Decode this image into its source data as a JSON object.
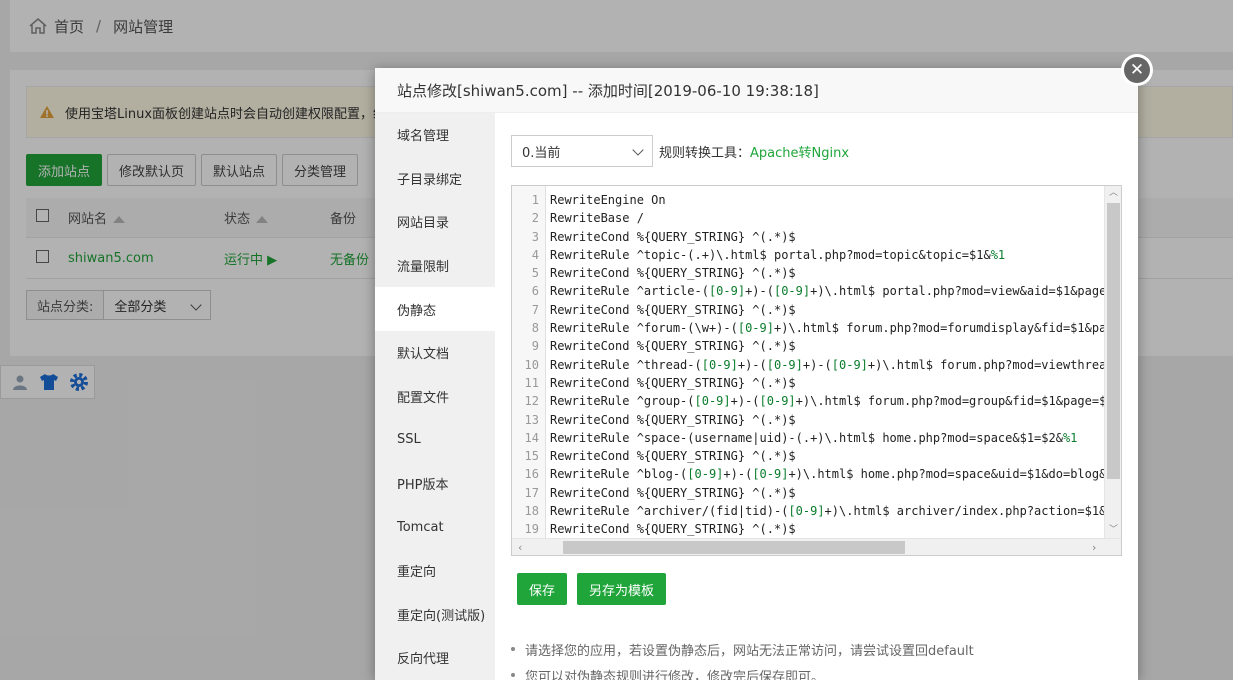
{
  "breadcrumb": {
    "home": "首页",
    "separator": "/",
    "current": "网站管理"
  },
  "alert": {
    "text": "使用宝塔Linux面板创建站点时会自动创建权限配置，统"
  },
  "toolbar": {
    "buttons": [
      "添加站点",
      "修改默认页",
      "默认站点",
      "分类管理"
    ]
  },
  "table": {
    "headers": {
      "name": "网站名",
      "status": "状态",
      "backup": "备份"
    },
    "rows": [
      {
        "name": "shiwan5.com",
        "status": "运行中 ▶",
        "backup": "无备份"
      }
    ]
  },
  "category": {
    "label": "站点分类:",
    "value": "全部分类"
  },
  "modal": {
    "title": "站点修改[shiwan5.com] -- 添加时间[2019-06-10 19:38:18]",
    "close": "✕",
    "nav": [
      "域名管理",
      "子目录绑定",
      "网站目录",
      "流量限制",
      "伪静态",
      "默认文档",
      "配置文件",
      "SSL",
      "PHP版本",
      "Tomcat",
      "重定向",
      "重定向(测试版)",
      "反向代理"
    ],
    "active_nav": "伪静态",
    "version_select": "0.当前",
    "tool_label": "规则转换工具：",
    "tool_link": "Apache转Nginx",
    "code_lines": [
      "RewriteEngine On",
      "RewriteBase /",
      "RewriteCond %{QUERY_STRING} ^(.*)$",
      "RewriteRule ^topic-(.+)\\.html$ portal.php?mod=topic&topic=$1&%1",
      "RewriteCond %{QUERY_STRING} ^(.*)$",
      "RewriteRule ^article-([0-9]+)-([0-9]+)\\.html$ portal.php?mod=view&aid=$1&page",
      "RewriteCond %{QUERY_STRING} ^(.*)$",
      "RewriteRule ^forum-(\\w+)-([0-9]+)\\.html$ forum.php?mod=forumdisplay&fid=$1&pa",
      "RewriteCond %{QUERY_STRING} ^(.*)$",
      "RewriteRule ^thread-([0-9]+)-([0-9]+)-([0-9]+)\\.html$ forum.php?mod=viewthrea",
      "RewriteCond %{QUERY_STRING} ^(.*)$",
      "RewriteRule ^group-([0-9]+)-([0-9]+)\\.html$ forum.php?mod=group&fid=$1&page=$",
      "RewriteCond %{QUERY_STRING} ^(.*)$",
      "RewriteRule ^space-(username|uid)-(.+)\\.html$ home.php?mod=space&$1=$2&%1",
      "RewriteCond %{QUERY_STRING} ^(.*)$",
      "RewriteRule ^blog-([0-9]+)-([0-9]+)\\.html$ home.php?mod=space&uid=$1&do=blog&",
      "RewriteCond %{QUERY_STRING} ^(.*)$",
      "RewriteRule ^archiver/(fid|tid)-([0-9]+)\\.html$ archiver/index.php?action=$1&",
      "RewriteCond %{QUERY_STRING} ^(.*)$"
    ],
    "save_label": "保存",
    "save_template_label": "另存为模板",
    "tips": [
      "请选择您的应用，若设置伪静态后，网站无法正常访问，请尝试设置回default",
      "您可以对伪静态规则进行修改，修改完后保存即可。"
    ]
  },
  "colors": {
    "accent": "#20a53a",
    "overlay": "rgba(0,0,0,0.3)"
  }
}
